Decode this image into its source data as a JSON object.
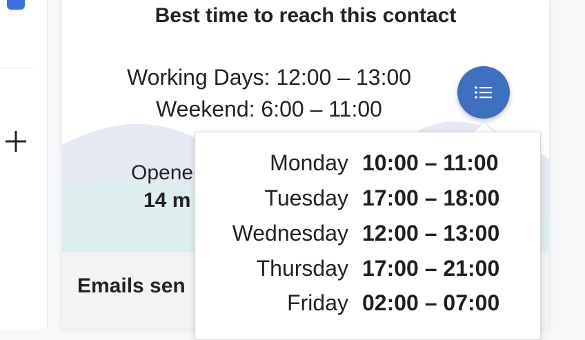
{
  "card": {
    "title": "Best time to reach this contact",
    "working_days_label": "Working Days:",
    "working_days_value": "12:00 – 13:00",
    "weekend_label": "Weekend:",
    "weekend_value": "6:00 – 11:00",
    "opened_text": "Opene",
    "opened_sub": "14 m",
    "emails_label": "Emails sen"
  },
  "popover": {
    "rows": [
      {
        "day": "Monday",
        "time": "10:00 – 11:00"
      },
      {
        "day": "Tuesday",
        "time": "17:00 – 18:00"
      },
      {
        "day": "Wednesday",
        "time": "12:00 – 13:00"
      },
      {
        "day": "Thursday",
        "time": "17:00 – 21:00"
      },
      {
        "day": "Friday",
        "time": "02:00 – 07:00"
      }
    ]
  },
  "icons": {
    "fab": "list-icon",
    "rail": "plus-icon"
  },
  "colors": {
    "fab": "#3f6fbf",
    "rail_badge": "#3d6fe0"
  }
}
